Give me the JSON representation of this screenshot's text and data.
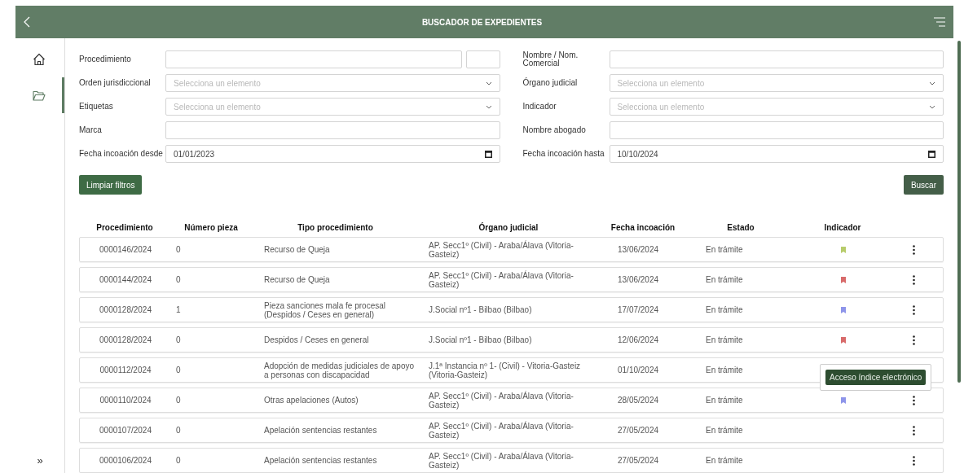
{
  "header": {
    "title": "BUSCADOR DE EXPEDIENTES"
  },
  "sidebar": {
    "items": [
      {
        "kind": "home",
        "selected": false
      },
      {
        "kind": "folder",
        "selected": true
      }
    ],
    "expand": "»"
  },
  "filters": {
    "left": [
      {
        "kind": "text_pair",
        "label": "Procedimiento"
      },
      {
        "kind": "select",
        "label": "Orden jurisdiccional",
        "placeholder": "Selecciona un elemento"
      },
      {
        "kind": "select",
        "label": "Etiquetas",
        "placeholder": "Selecciona un elemento"
      },
      {
        "kind": "text",
        "label": "Marca"
      },
      {
        "kind": "date",
        "label": "Fecha incoación desde",
        "value": "01/01/2023"
      }
    ],
    "right": [
      {
        "kind": "text",
        "label": "Nombre / Nom. Comercial"
      },
      {
        "kind": "select",
        "label": "Órgano judicial",
        "placeholder": "Selecciona un elemento"
      },
      {
        "kind": "select",
        "label": "Indicador",
        "placeholder": "Selecciona un elemento"
      },
      {
        "kind": "text",
        "label": "Nombre abogado"
      },
      {
        "kind": "date",
        "label": "Fecha incoación hasta",
        "value": "10/10/2024"
      }
    ]
  },
  "buttons": {
    "clear": "Limpiar filtros",
    "search": "Buscar"
  },
  "table": {
    "columns": [
      "Procedimiento",
      "Número pieza",
      "Tipo procedimiento",
      "Órgano judicial",
      "Fecha incoación",
      "Estado",
      "Indicador"
    ],
    "rows": [
      {
        "procedimiento": "0000146/2024",
        "pieza": "0",
        "tipo": "Recurso de Queja",
        "organo": "AP. Secc1º (Civil) - Araba/Álava (Vitoria-Gasteiz)",
        "fecha": "13/06/2024",
        "estado": "En trámite",
        "color": "#b7cc6b"
      },
      {
        "procedimiento": "0000144/2024",
        "pieza": "0",
        "tipo": "Recurso de Queja",
        "organo": "AP. Secc1º (Civil) - Araba/Álava (Vitoria-Gasteiz)",
        "fecha": "13/06/2024",
        "estado": "En trámite",
        "color": "#d86b6b"
      },
      {
        "procedimiento": "0000128/2024",
        "pieza": "1",
        "tipo": "Pieza sanciones mala fe procesal (Despidos / Ceses en general)",
        "organo": "J.Social nº1 - Bilbao (Bilbao)",
        "fecha": "17/07/2024",
        "estado": "En trámite",
        "color": "#8e95ea"
      },
      {
        "procedimiento": "0000128/2024",
        "pieza": "0",
        "tipo": "Despidos / Ceses en general",
        "organo": "J.Social nº1 - Bilbao (Bilbao)",
        "fecha": "12/06/2024",
        "estado": "En trámite",
        "color": "#d86b6b"
      },
      {
        "procedimiento": "0000112/2024",
        "pieza": "0",
        "tipo": "Adopción de medidas judiciales de apoyo a personas con discapacidad",
        "organo": "J.1ª Instancia nº 1- (Civil) - Vitoria-Gasteiz (Vitoria-Gasteiz)",
        "fecha": "01/10/2024",
        "estado": "En trámite",
        "tooltip": "Acceso índice electrónico"
      },
      {
        "procedimiento": "0000110/2024",
        "pieza": "0",
        "tipo": "Otras apelaciones (Autos)",
        "organo": "AP. Secc1º (Civil) - Araba/Álava (Vitoria-Gasteiz)",
        "fecha": "28/05/2024",
        "estado": "En trámite",
        "color": "#8e95ea"
      },
      {
        "procedimiento": "0000107/2024",
        "pieza": "0",
        "tipo": "Apelación sentencias restantes",
        "organo": "AP. Secc1º (Civil) - Araba/Álava (Vitoria-Gasteiz)",
        "fecha": "27/05/2024",
        "estado": "En trámite"
      },
      {
        "procedimiento": "0000106/2024",
        "pieza": "0",
        "tipo": "Apelación sentencias restantes",
        "organo": "AP. Secc1º (Civil) - Araba/Álava (Vitoria-Gasteiz)",
        "fecha": "27/05/2024",
        "estado": "En trámite"
      }
    ]
  }
}
